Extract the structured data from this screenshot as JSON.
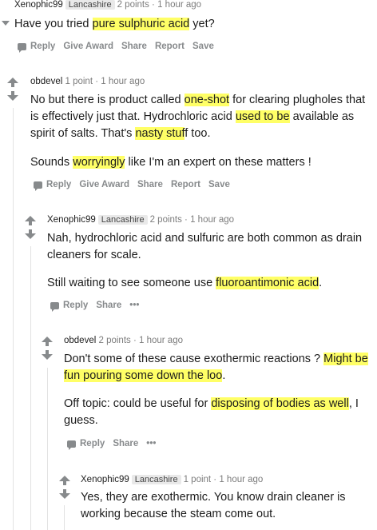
{
  "c0": {
    "user": "Xenophic99",
    "flair": "Lancashire",
    "meta": "2 points · 1 hour ago",
    "text_pre": "Have you tried ",
    "text_hl": "pure sulphuric acid",
    "text_post": " yet?",
    "actions": [
      "Reply",
      "Give Award",
      "Share",
      "Report",
      "Save"
    ]
  },
  "c1": {
    "user": "obdevel",
    "meta": "1 point · 1 hour ago",
    "p1_a": "No but there is product called ",
    "p1_hl1": "one-shot",
    "p1_b": " for clearing plugholes that is effectively just that. Hydrochloric acid ",
    "p1_hl2": "used to be",
    "p1_c": " available as spirit of salts. That's ",
    "p1_hl3": "nasty stuf",
    "p1_d": "f too.",
    "p2_a": "Sounds ",
    "p2_hl": "worryingly",
    "p2_b": " like I'm an expert on these matters !",
    "actions": [
      "Reply",
      "Give Award",
      "Share",
      "Report",
      "Save"
    ]
  },
  "c2": {
    "user": "Xenophic99",
    "flair": "Lancashire",
    "meta": "2 points · 1 hour ago",
    "p1": "Nah, hydrochloric acid and sulfuric are both common as drain cleaners for scale.",
    "p2_a": "Still waiting to see someone use ",
    "p2_hl": "fluoroantimonic acid",
    ".": "",
    "p2_b": ".",
    "actions": [
      "Reply",
      "Share",
      "•••"
    ]
  },
  "c3": {
    "user": "obdevel",
    "meta": "2 points · 1 hour ago",
    "p1_a": "Don't some of these cause exothermic reactions ? ",
    "p1_hl": "Might be fun pouring some down the loo",
    "p1_b": ".",
    "p2_a": "Off topic: could be useful for ",
    "p2_hl": "disposing of bodies as well",
    "p2_b": ", I guess.",
    "actions": [
      "Reply",
      "Share",
      "•••"
    ]
  },
  "c4": {
    "user": "Xenophic99",
    "flair": "Lancashire",
    "meta": "1 point · 1 hour ago",
    "p1": "Yes, they are exothermic. You know drain cleaner is working because the steam come out."
  }
}
